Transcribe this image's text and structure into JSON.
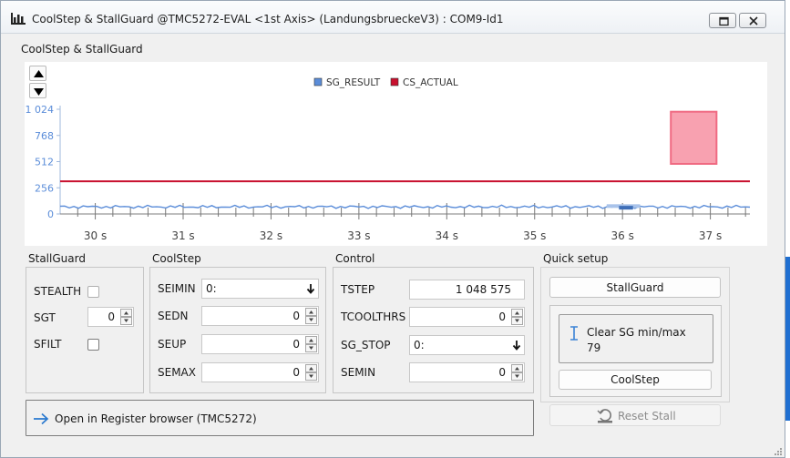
{
  "window": {
    "title": "CoolStep & StallGuard @TMC5272-EVAL <1st Axis> (LandungsbrueckeV3) : COM9-Id1",
    "restore_icon": "restore-icon",
    "close_icon": "close-icon"
  },
  "group_title": "CoolStep & StallGuard",
  "chart_data": {
    "type": "line",
    "legend_position": "top-center",
    "series": [
      {
        "name": "SG_RESULT",
        "color": "#5b8dd9",
        "approx_value": 70
      },
      {
        "name": "CS_ACTUAL",
        "color": "#c8102e",
        "approx_value": 320
      }
    ],
    "x_unit": "s",
    "x_ticks": [
      "30 s",
      "31 s",
      "32 s",
      "33 s",
      "34 s",
      "35 s",
      "36 s",
      "37 s"
    ],
    "xlim": [
      29.6,
      37.45
    ],
    "y_ticks": [
      "0",
      "256",
      "512",
      "768",
      "1 024"
    ],
    "ylim": [
      0,
      1024
    ],
    "grid": false,
    "highlight_box": {
      "x_from": 36.55,
      "x_to": 37.07,
      "y_from": 490,
      "y_to": 1000,
      "color": "#f8a1b0"
    }
  },
  "stallguard": {
    "title": "StallGuard",
    "stealth_label": "STEALTH",
    "stealth_checked": false,
    "sgt_label": "SGT",
    "sgt_value": "0",
    "sfilt_label": "SFILT",
    "sfilt_checked": false
  },
  "coolstep": {
    "title": "CoolStep",
    "seimin_label": "SEIMIN",
    "seimin_value": "0:",
    "sedn_label": "SEDN",
    "sedn_value": "0",
    "seup_label": "SEUP",
    "seup_value": "0",
    "semax_label": "SEMAX",
    "semax_value": "0"
  },
  "control": {
    "title": "Control",
    "tstep_label": "TSTEP",
    "tstep_value": "1 048 575",
    "tcoolthrs_label": "TCOOLTHRS",
    "tcoolthrs_value": "0",
    "sg_stop_label": "SG_STOP",
    "sg_stop_value": "0:",
    "semin_label": "SEMIN",
    "semin_value": "0"
  },
  "quick_setup": {
    "title": "Quick setup",
    "stallguard_button": "StallGuard",
    "clear_label": "Clear SG min/max",
    "clear_value": "79",
    "coolstep_button": "CoolStep",
    "reset_stall": "Reset Stall"
  },
  "register_browser_link": "Open in Register browser (TMC5272)",
  "icons": {
    "app": "chart-bars-icon",
    "up": "arrow-up-icon",
    "down": "arrow-down-icon",
    "clear": "text-cursor-icon",
    "link": "arrow-right-icon",
    "reset": "reset-stall-icon"
  }
}
